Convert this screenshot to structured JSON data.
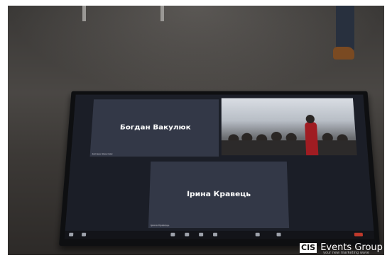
{
  "scene": {
    "participants": [
      {
        "name": "Богдан Вакулюк",
        "tag": "Богдан Вакулюк"
      },
      {
        "name": "Ірина Кравець",
        "tag": "Ірина Кравець"
      }
    ],
    "watermark": {
      "logo_mark": "CIS",
      "brand": "Events Group",
      "tagline": "your new marketing wave"
    }
  }
}
